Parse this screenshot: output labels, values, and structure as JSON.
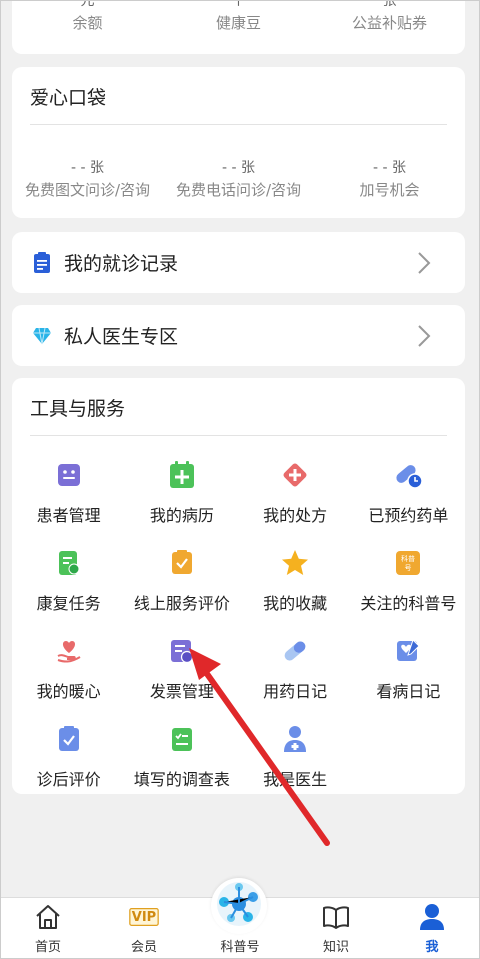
{
  "top_stats": [
    {
      "value": "元",
      "label": "余额"
    },
    {
      "value": "个",
      "label": "健康豆"
    },
    {
      "value": "张",
      "label": "公益补贴券"
    }
  ],
  "pocket": {
    "title": "爱心口袋",
    "items": [
      {
        "value": "- - 张",
        "label": "免费图文问诊/咨询"
      },
      {
        "value": "- - 张",
        "label": "免费电话问诊/咨询"
      },
      {
        "value": "- - 张",
        "label": "加号机会"
      }
    ]
  },
  "records": {
    "label": "我的就诊记录",
    "icon": "clipboard-icon"
  },
  "private_doctor": {
    "label": "私人医生专区",
    "icon": "diamond-icon"
  },
  "tools": {
    "title": "工具与服务",
    "rows": [
      [
        {
          "label": "患者管理",
          "icon": "patient-icon"
        },
        {
          "label": "我的病历",
          "icon": "medical-record-icon"
        },
        {
          "label": "我的处方",
          "icon": "prescription-icon"
        },
        {
          "label": "已预约药单",
          "icon": "pill-clock-icon"
        }
      ],
      [
        {
          "label": "康复任务",
          "icon": "rehab-task-icon"
        },
        {
          "label": "线上服务评价",
          "icon": "review-icon"
        },
        {
          "label": "我的收藏",
          "icon": "star-icon"
        },
        {
          "label": "关注的科普号",
          "icon": "science-icon"
        }
      ],
      [
        {
          "label": "我的暖心",
          "icon": "heart-hand-icon"
        },
        {
          "label": "发票管理",
          "icon": "invoice-icon"
        },
        {
          "label": "用药日记",
          "icon": "pill-icon"
        },
        {
          "label": "看病日记",
          "icon": "diary-icon"
        }
      ],
      [
        {
          "label": "诊后评价",
          "icon": "clipboard-check-icon"
        },
        {
          "label": "填写的调查表",
          "icon": "survey-icon"
        },
        {
          "label": "我是医生",
          "icon": "doctor-icon"
        }
      ]
    ]
  },
  "tabbar": {
    "tabs": [
      {
        "label": "首页",
        "icon": "home-icon"
      },
      {
        "label": "会员",
        "icon": "vip-icon",
        "badge": "VIP"
      },
      {
        "label": "科普号",
        "icon": "science-hub-icon"
      },
      {
        "label": "知识",
        "icon": "book-icon"
      },
      {
        "label": "我",
        "icon": "person-icon",
        "active": true
      }
    ]
  },
  "colors": {
    "accent": "#1a5fd6",
    "arrow": "#e0282a",
    "purple": "#7b6fd6",
    "green": "#4cc259",
    "orange": "#f0a830",
    "red": "#e86a6a"
  }
}
